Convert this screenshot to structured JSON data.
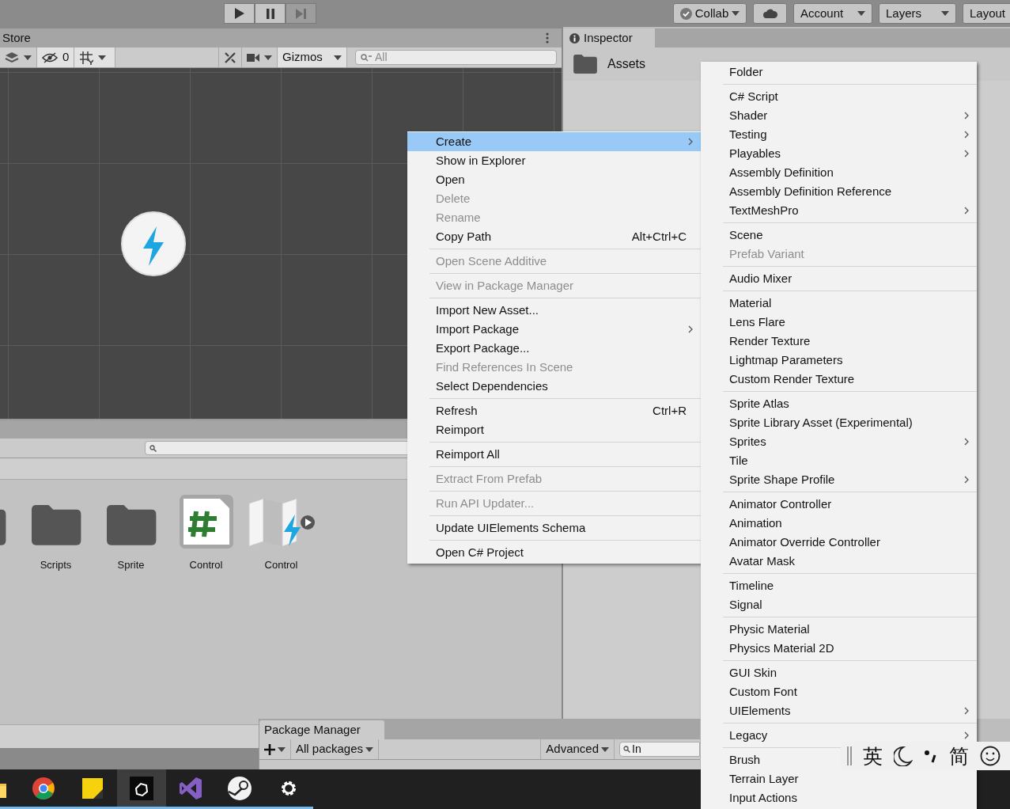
{
  "toolbar": {
    "play_buttons": [
      {
        "kind": "play",
        "disabled": false
      },
      {
        "kind": "pause",
        "disabled": false
      },
      {
        "kind": "step",
        "disabled": true
      }
    ],
    "collab": "Collab",
    "account": "Account",
    "layers": "Layers",
    "layout": "Layout"
  },
  "scene_panel": {
    "tab": "Store",
    "hidden_count": "0",
    "gizmos": "Gizmos",
    "search_placeholder": "All"
  },
  "project_panel": {
    "assets": [
      {
        "kind": "folder",
        "selected": false
      },
      {
        "kind": "folder",
        "name": "Scripts",
        "selected": false
      },
      {
        "kind": "folder",
        "name": "Sprite",
        "selected": false
      },
      {
        "kind": "script",
        "name": "Control",
        "selected": true
      },
      {
        "kind": "input",
        "name": "Control",
        "selected": false
      }
    ]
  },
  "inspector": {
    "tab": "Inspector",
    "title": "Assets"
  },
  "context_menu": {
    "groups": [
      [
        {
          "label": "Create",
          "selected": true,
          "disabled": false,
          "submenu": true
        },
        {
          "label": "Show in Explorer",
          "selected": false,
          "disabled": false,
          "submenu": false
        },
        {
          "label": "Open",
          "selected": false,
          "disabled": false,
          "submenu": false
        },
        {
          "label": "Delete",
          "selected": false,
          "disabled": true,
          "submenu": false
        },
        {
          "label": "Rename",
          "selected": false,
          "disabled": true,
          "submenu": false
        },
        {
          "label": "Copy Path",
          "shortcut": "Alt+Ctrl+C",
          "selected": false,
          "disabled": false,
          "submenu": false
        }
      ],
      [
        {
          "label": "Open Scene Additive",
          "selected": false,
          "disabled": true,
          "submenu": false
        }
      ],
      [
        {
          "label": "View in Package Manager",
          "selected": false,
          "disabled": true,
          "submenu": false
        }
      ],
      [
        {
          "label": "Import New Asset...",
          "selected": false,
          "disabled": false,
          "submenu": false
        },
        {
          "label": "Import Package",
          "selected": false,
          "disabled": false,
          "submenu": true
        },
        {
          "label": "Export Package...",
          "selected": false,
          "disabled": false,
          "submenu": false
        },
        {
          "label": "Find References In Scene",
          "selected": false,
          "disabled": true,
          "submenu": false
        },
        {
          "label": "Select Dependencies",
          "selected": false,
          "disabled": false,
          "submenu": false
        }
      ],
      [
        {
          "label": "Refresh",
          "shortcut": "Ctrl+R",
          "selected": false,
          "disabled": false,
          "submenu": false
        },
        {
          "label": "Reimport",
          "selected": false,
          "disabled": false,
          "submenu": false
        }
      ],
      [
        {
          "label": "Reimport All",
          "selected": false,
          "disabled": false,
          "submenu": false
        }
      ],
      [
        {
          "label": "Extract From Prefab",
          "selected": false,
          "disabled": true,
          "submenu": false
        }
      ],
      [
        {
          "label": "Run API Updater...",
          "selected": false,
          "disabled": true,
          "submenu": false
        }
      ],
      [
        {
          "label": "Update UIElements Schema",
          "selected": false,
          "disabled": false,
          "submenu": false
        }
      ],
      [
        {
          "label": "Open C# Project",
          "selected": false,
          "disabled": false,
          "submenu": false
        }
      ]
    ]
  },
  "create_submenu": {
    "groups": [
      [
        {
          "label": "Folder",
          "disabled": false,
          "submenu": false
        }
      ],
      [
        {
          "label": "C# Script",
          "disabled": false,
          "submenu": false
        },
        {
          "label": "Shader",
          "disabled": false,
          "submenu": true
        },
        {
          "label": "Testing",
          "disabled": false,
          "submenu": true
        },
        {
          "label": "Playables",
          "disabled": false,
          "submenu": true
        },
        {
          "label": "Assembly Definition",
          "disabled": false,
          "submenu": false
        },
        {
          "label": "Assembly Definition Reference",
          "disabled": false,
          "submenu": false
        },
        {
          "label": "TextMeshPro",
          "disabled": false,
          "submenu": true
        }
      ],
      [
        {
          "label": "Scene",
          "disabled": false,
          "submenu": false
        },
        {
          "label": "Prefab Variant",
          "disabled": true,
          "submenu": false
        }
      ],
      [
        {
          "label": "Audio Mixer",
          "disabled": false,
          "submenu": false
        }
      ],
      [
        {
          "label": "Material",
          "disabled": false,
          "submenu": false
        },
        {
          "label": "Lens Flare",
          "disabled": false,
          "submenu": false
        },
        {
          "label": "Render Texture",
          "disabled": false,
          "submenu": false
        },
        {
          "label": "Lightmap Parameters",
          "disabled": false,
          "submenu": false
        },
        {
          "label": "Custom Render Texture",
          "disabled": false,
          "submenu": false
        }
      ],
      [
        {
          "label": "Sprite Atlas",
          "disabled": false,
          "submenu": false
        },
        {
          "label": "Sprite Library Asset (Experimental)",
          "disabled": false,
          "submenu": false
        },
        {
          "label": "Sprites",
          "disabled": false,
          "submenu": true
        },
        {
          "label": "Tile",
          "disabled": false,
          "submenu": false
        },
        {
          "label": "Sprite Shape Profile",
          "disabled": false,
          "submenu": true
        }
      ],
      [
        {
          "label": "Animator Controller",
          "disabled": false,
          "submenu": false
        },
        {
          "label": "Animation",
          "disabled": false,
          "submenu": false
        },
        {
          "label": "Animator Override Controller",
          "disabled": false,
          "submenu": false
        },
        {
          "label": "Avatar Mask",
          "disabled": false,
          "submenu": false
        }
      ],
      [
        {
          "label": "Timeline",
          "disabled": false,
          "submenu": false
        },
        {
          "label": "Signal",
          "disabled": false,
          "submenu": false
        }
      ],
      [
        {
          "label": "Physic Material",
          "disabled": false,
          "submenu": false
        },
        {
          "label": "Physics Material 2D",
          "disabled": false,
          "submenu": false
        }
      ],
      [
        {
          "label": "GUI Skin",
          "disabled": false,
          "submenu": false
        },
        {
          "label": "Custom Font",
          "disabled": false,
          "submenu": false
        },
        {
          "label": "UIElements",
          "disabled": false,
          "submenu": true
        }
      ],
      [
        {
          "label": "Legacy",
          "disabled": false,
          "submenu": true
        }
      ],
      [
        {
          "label": "Brush",
          "disabled": false,
          "submenu": false
        },
        {
          "label": "Terrain Layer",
          "disabled": false,
          "submenu": false
        },
        {
          "label": "Input Actions",
          "disabled": false,
          "submenu": false
        }
      ]
    ]
  },
  "package_manager": {
    "title": "Package Manager",
    "filter": "All packages",
    "advanced": "Advanced",
    "search": "In"
  },
  "ime_bar": {
    "language": "英",
    "script": "简"
  },
  "taskbar": {
    "apps": [
      {
        "kind": "folder",
        "active": false
      },
      {
        "kind": "browser",
        "active": false
      },
      {
        "kind": "notes",
        "active": false
      },
      {
        "kind": "unity",
        "active": true
      },
      {
        "kind": "vs",
        "active": false
      },
      {
        "kind": "steam",
        "active": false
      },
      {
        "kind": "settings",
        "active": false
      }
    ]
  }
}
